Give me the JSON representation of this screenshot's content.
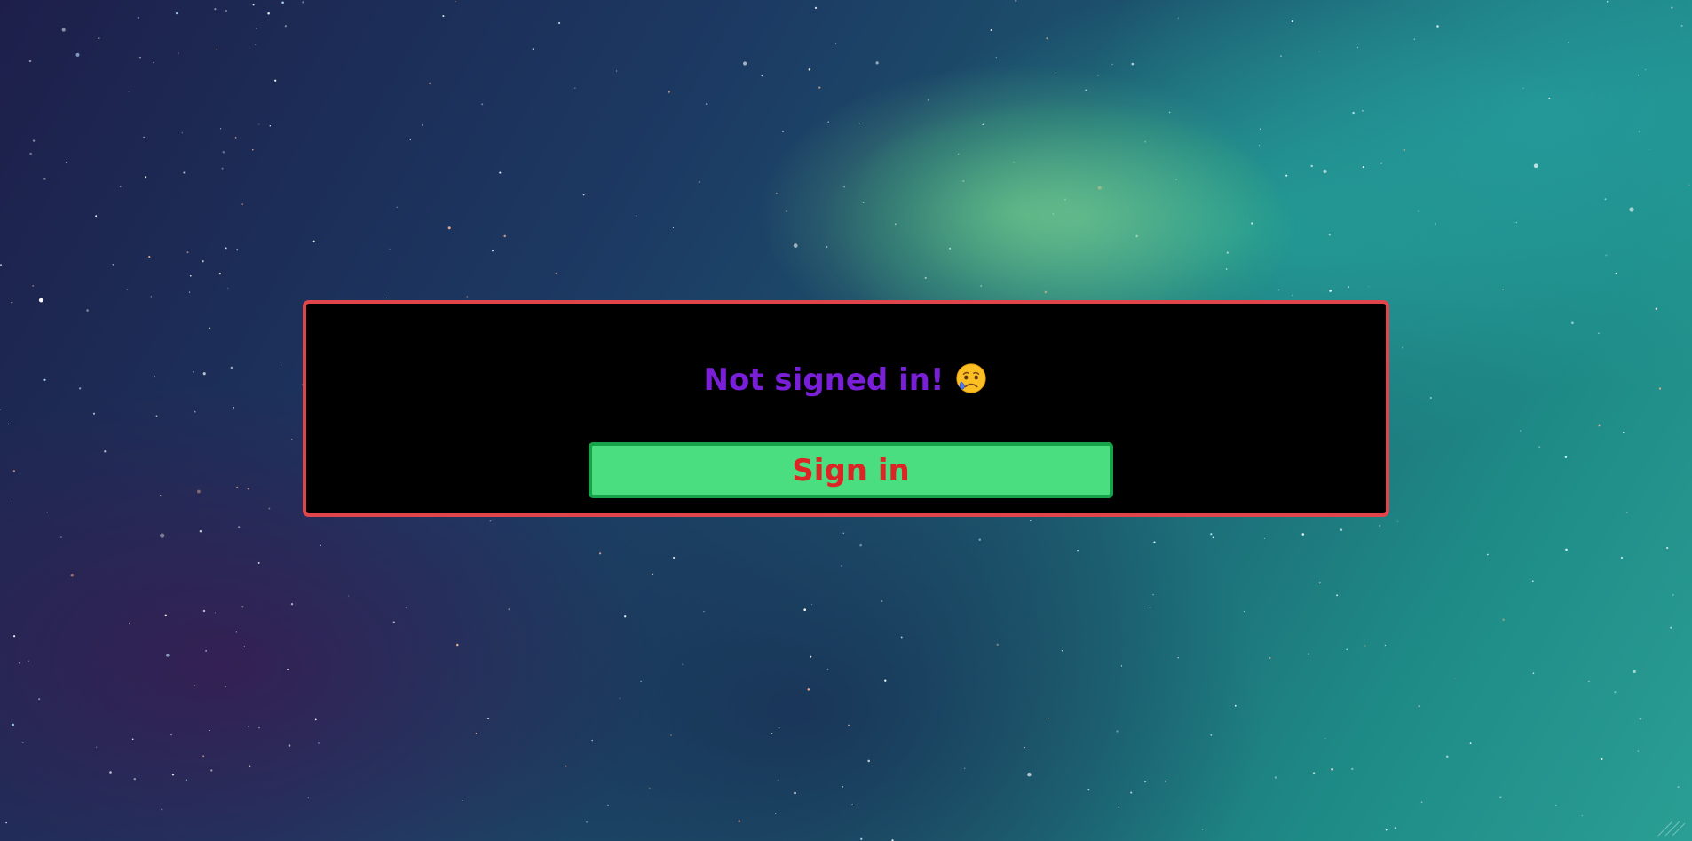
{
  "auth_panel": {
    "message": "Not signed in!",
    "emoji": "sad-but-relieved-face",
    "button_label": "Sign in"
  },
  "colors": {
    "panel_background": "#000000",
    "panel_border": "#e0454b",
    "message_text": "#7a1fd8",
    "button_background": "#4ade80",
    "button_border": "#16a34a",
    "button_text": "#dc2626"
  }
}
